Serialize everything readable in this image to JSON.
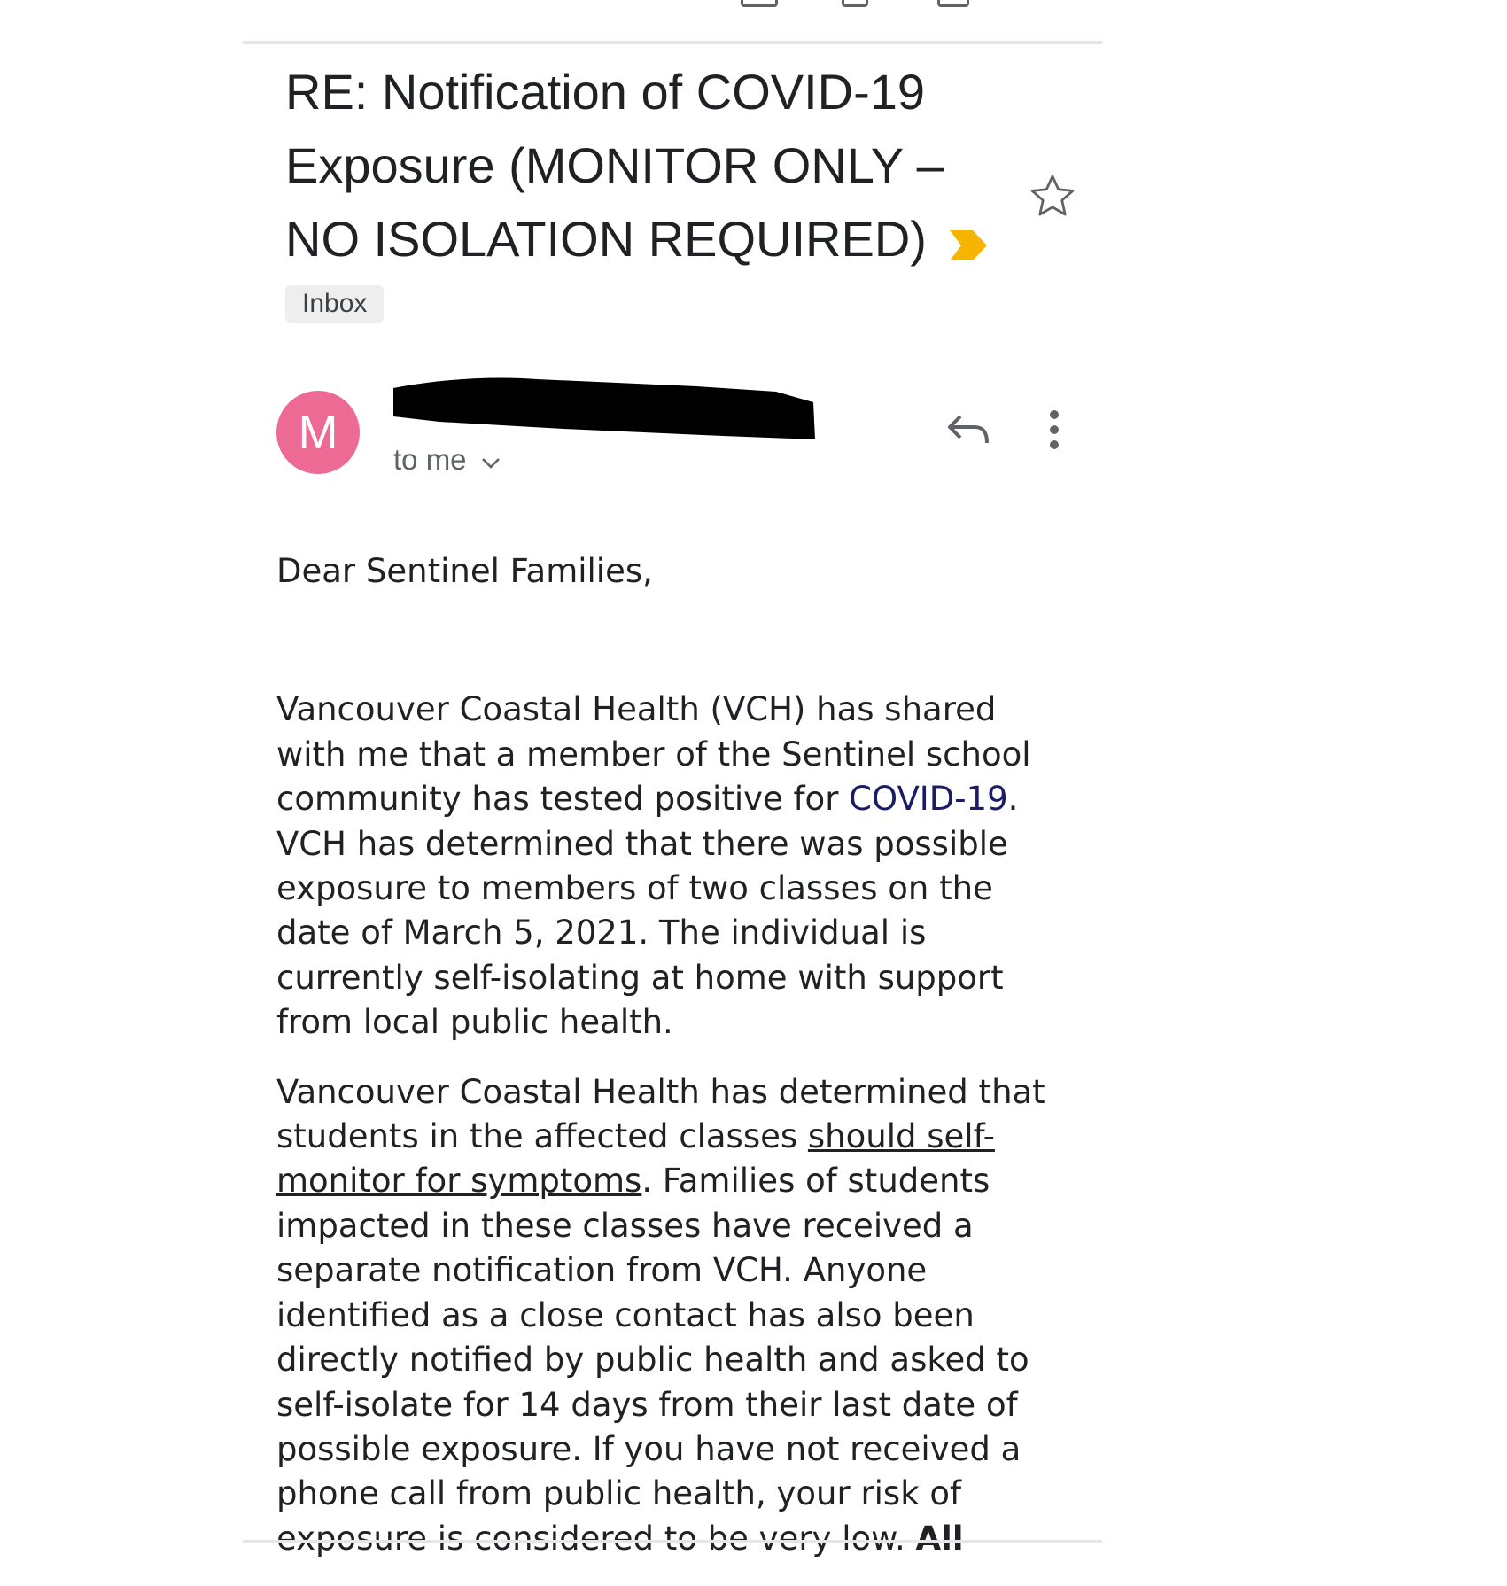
{
  "email": {
    "subject": {
      "line1": "RE: Notification of COVID-19",
      "line2": "Exposure  (MONITOR ONLY –",
      "line3": "NO ISOLATION REQUIRED)"
    },
    "label": "Inbox",
    "avatar_initial": "M",
    "recipient": "to me"
  },
  "body": {
    "greeting": "Dear Sentinel Families,",
    "p1": {
      "part1": "Vancouver Coastal Health (VCH) has shared with me that a member of the Sentinel school community has tested positive for ",
      "link": "COVID-19",
      "part2": ". VCH has determined that there was possible exposure to members of two classes on the date of March 5, 2021. The individual is currently self-isolating at home with support from local public health."
    },
    "p2": {
      "part1": "Vancouver Coastal Health has determined that students in the affected classes ",
      "underlined": "should self-monitor for symptoms",
      "part2": ".   Families of students impacted in these classes have received a separate notification from VCH.  Anyone identified as a close contact has also been directly notified by public health and asked to self-isolate for 14 days from their last date of possible exposure.  If you have not received a phone call from public health, your risk of exposure is considered to be very low.  ",
      "bold": "All"
    }
  },
  "colors": {
    "avatar_bg": "#ec6a94",
    "importance_marker": "#f6b400",
    "link": "#1a1c68"
  },
  "icons": [
    "importance-marker-icon",
    "star-icon",
    "reply-icon",
    "more-vert-icon",
    "chevron-down-icon"
  ]
}
